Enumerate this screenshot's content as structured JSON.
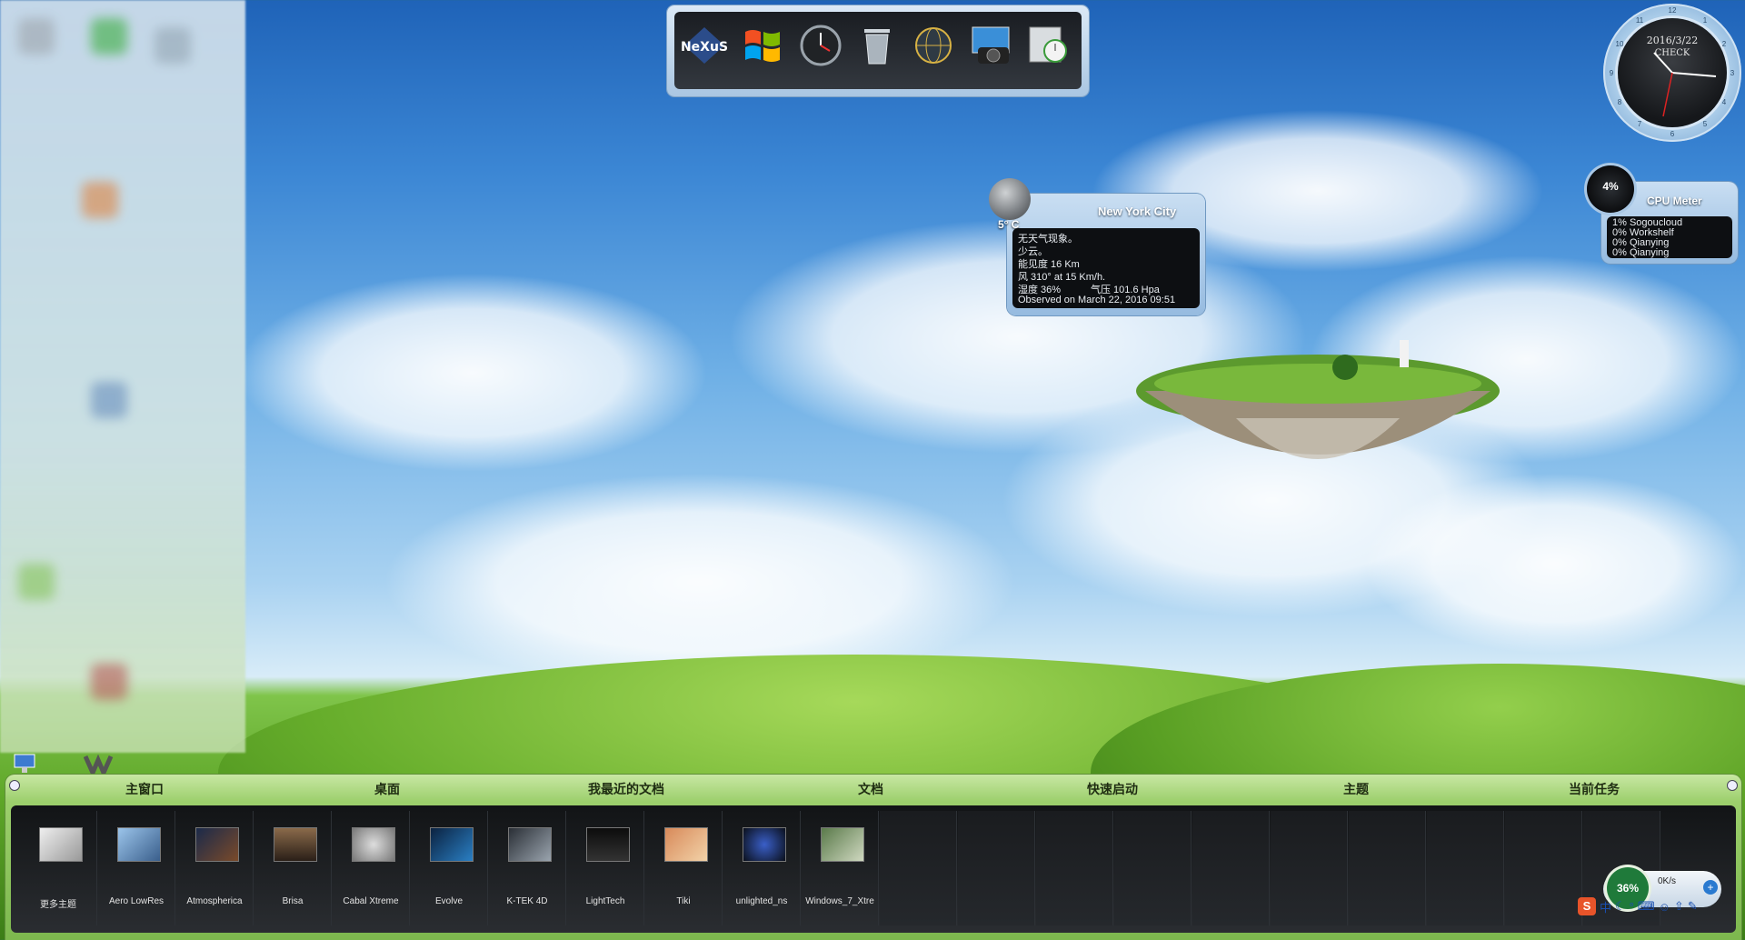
{
  "dock": {
    "items": [
      {
        "name": "nexus-icon",
        "label": "NeXuS"
      },
      {
        "name": "windows-logo-icon",
        "label": ""
      },
      {
        "name": "clock-icon",
        "label": ""
      },
      {
        "name": "trash-icon",
        "label": ""
      },
      {
        "name": "network-globe-icon",
        "label": ""
      },
      {
        "name": "camera-icon",
        "label": ""
      },
      {
        "name": "system-clock-icon",
        "label": ""
      }
    ]
  },
  "clock": {
    "date": "2016/3/22",
    "status": "CHECK",
    "numbers": [
      "12",
      "1",
      "2",
      "3",
      "4",
      "5",
      "6",
      "7",
      "8",
      "9",
      "10",
      "11"
    ]
  },
  "weather": {
    "city": "New York City",
    "temp": "5° C",
    "lines": [
      "无天气现象。",
      "少云。",
      "能见度 16 Km",
      "风 310° at 15 Km/h.",
      "湿度 36%",
      "气压 101.6 Hpa",
      "Observed on March 22, 2016 09:51"
    ]
  },
  "cpu": {
    "percent": "4%",
    "title": "CPU Meter",
    "processes": [
      "1% Sogoucloud",
      "0% Workshelf",
      "0% Qianying",
      "0% Qianying"
    ]
  },
  "taskbar": {
    "tabs": [
      "主窗口",
      "桌面",
      "我最近的文档",
      "文档",
      "快速启动",
      "主题",
      "当前任务"
    ],
    "themes": [
      "更多主题",
      "Aero LowRes",
      "Atmospherica",
      "Brisa",
      "Cabal Xtreme",
      "Evolve",
      "K-TEK 4D",
      "LightTech",
      "Tiki",
      "unlighted_ns",
      "Windows_7_Xtre"
    ]
  },
  "tray": {
    "net_percent": "36%",
    "speed_up": "0K/s",
    "ime_label": "中"
  },
  "colors": {
    "sky_top": "#1f63b8",
    "grass": "#5ea628",
    "dock_frame": "#aac6e2",
    "taskbar": "#9ccf6c",
    "panel_dark": "#0d0f12"
  }
}
